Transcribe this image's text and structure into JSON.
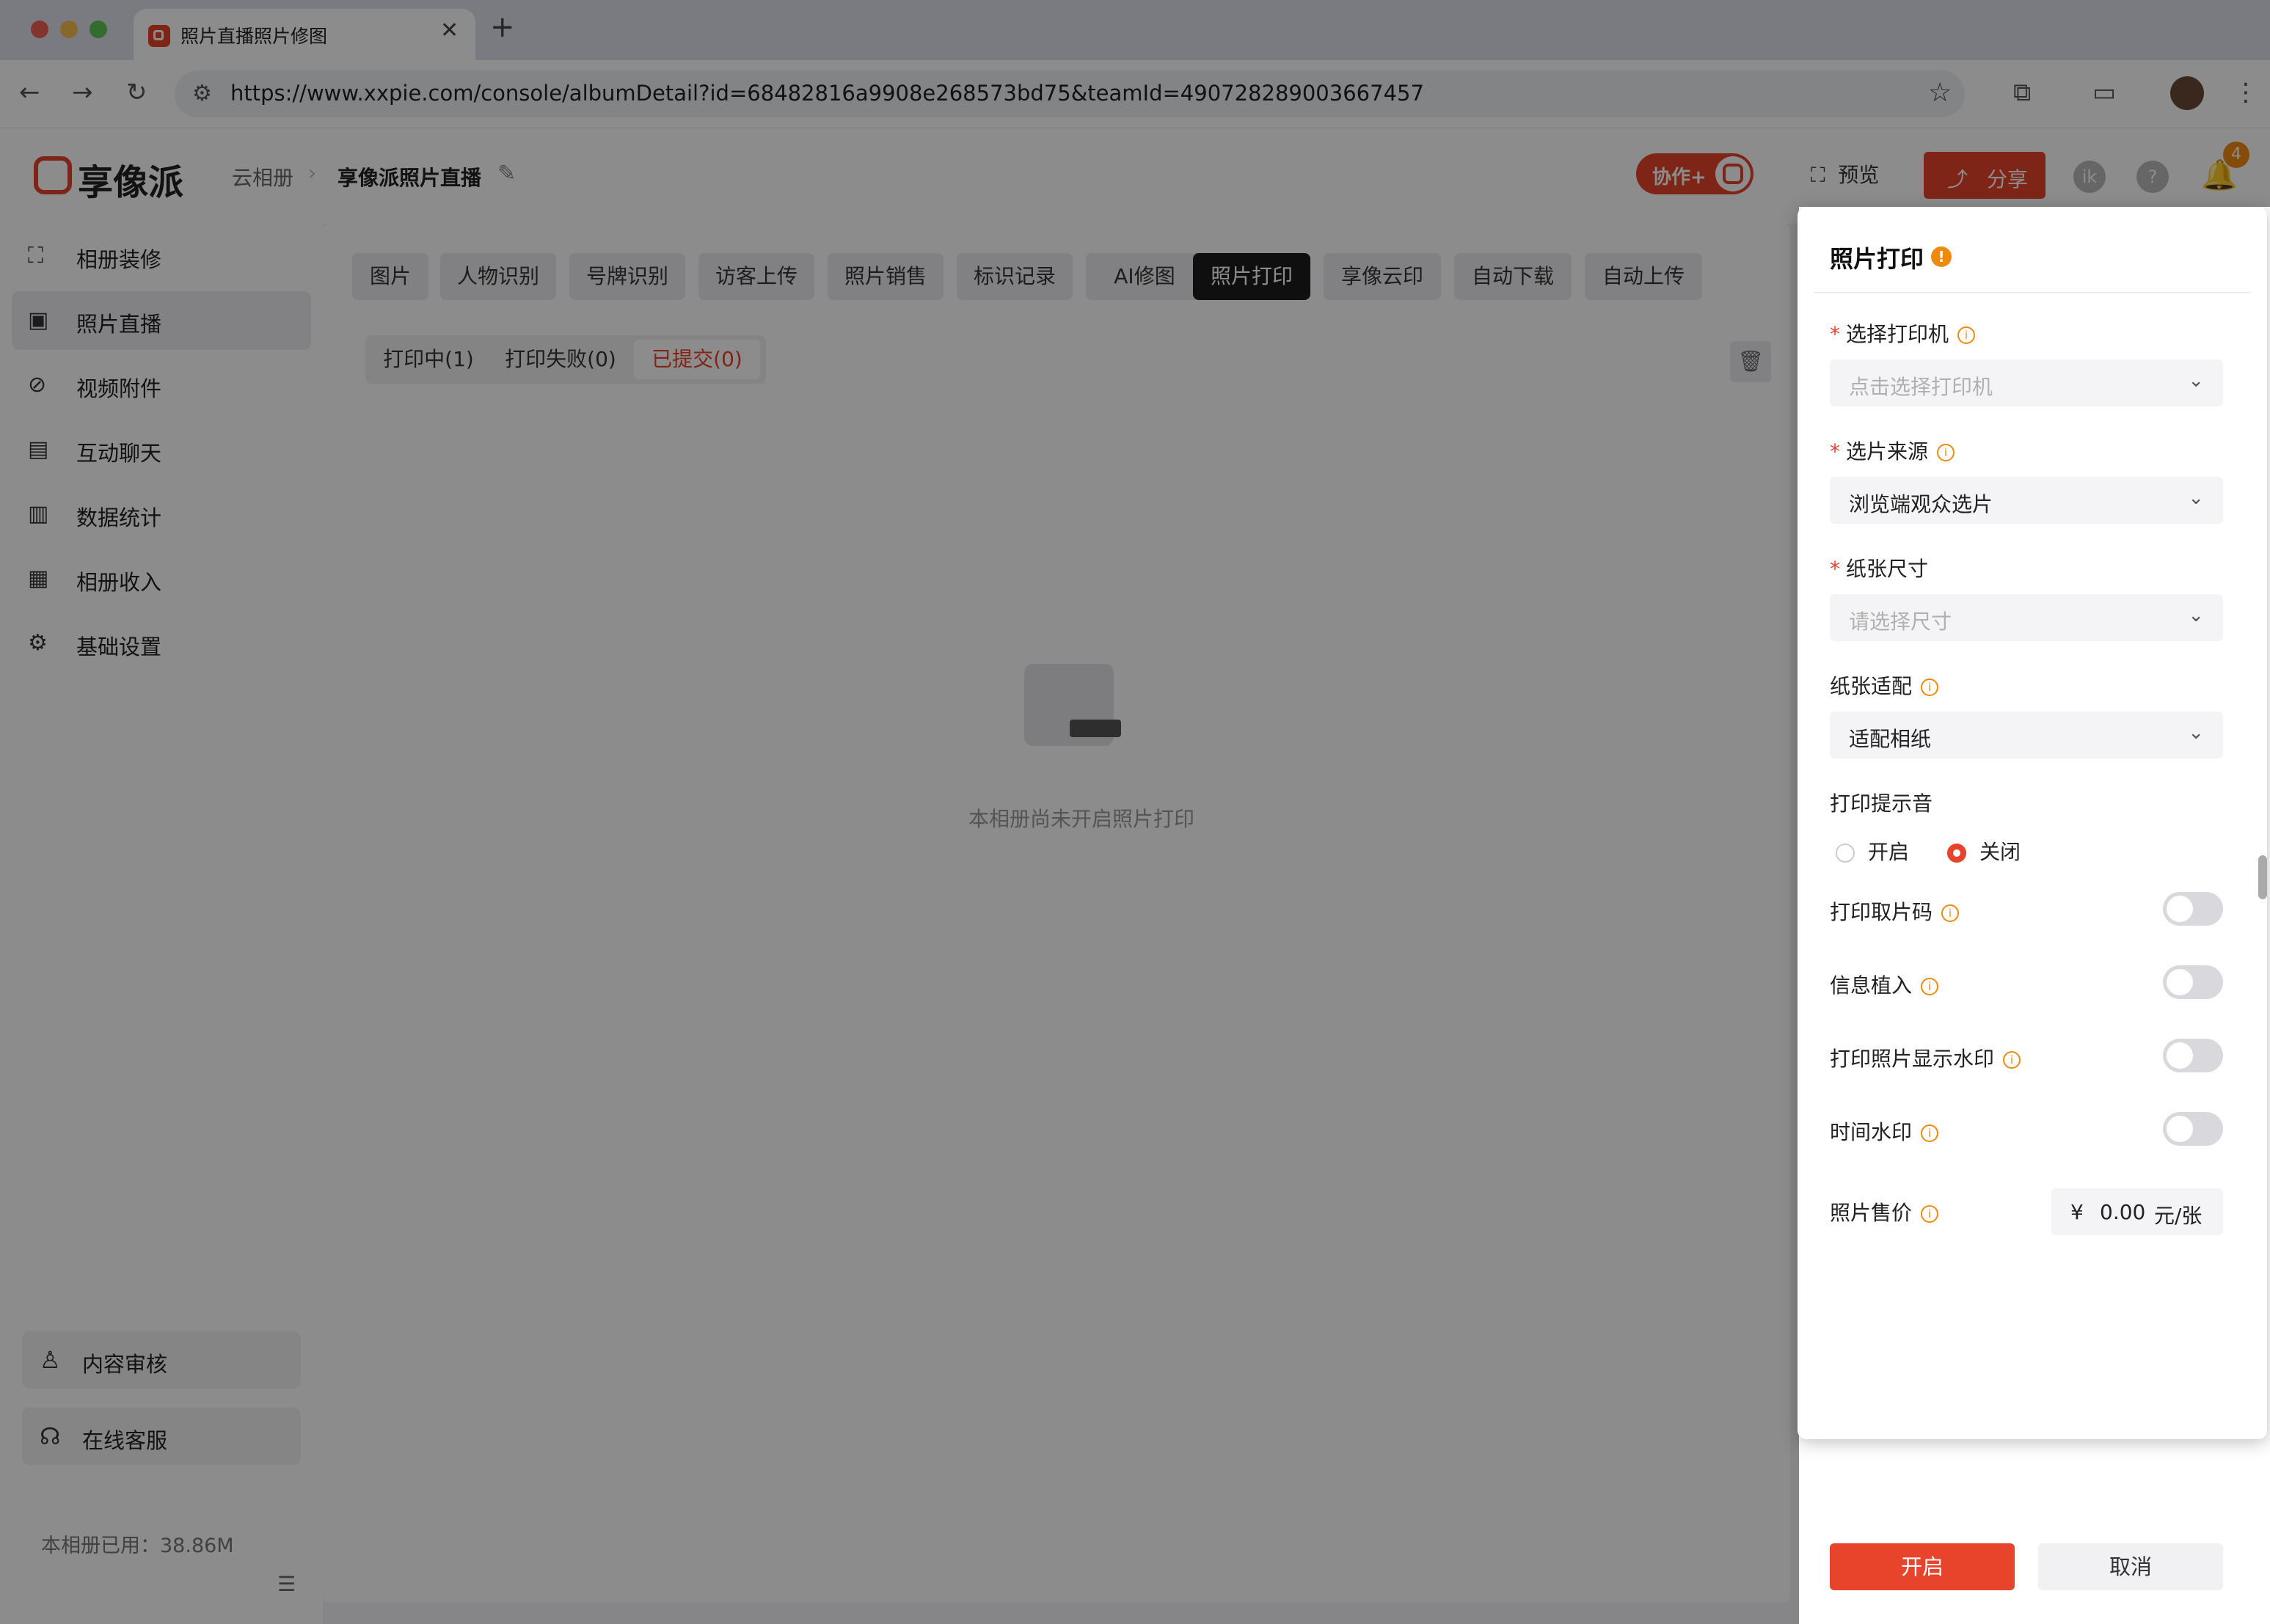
{
  "browser": {
    "tab_title": "照片直播照片修图",
    "tab_close": "✕",
    "new_tab": "+",
    "url": "https://www.xxpie.com/console/albumDetail?id=68482816a9908e268573bd75&teamId=490728289003667457",
    "colors": {
      "close": "#ee5f57",
      "minimize": "#f5bd4f",
      "maximize": "#5fc454"
    }
  },
  "header": {
    "logo_text": "享像派",
    "breadcrumb_root": "云相册",
    "breadcrumb_current": "享像派照片直播",
    "collab_label": "协作+",
    "preview_label": "预览",
    "share_label": "分享",
    "avatar_letter": "ik",
    "help": "?",
    "notification_count": "4"
  },
  "sidebar": {
    "items": [
      {
        "label": "相册装修",
        "icon": "frame-icon"
      },
      {
        "label": "照片直播",
        "icon": "image-icon",
        "active": true
      },
      {
        "label": "视频附件",
        "icon": "paperclip-icon"
      },
      {
        "label": "互动聊天",
        "icon": "chat-icon"
      },
      {
        "label": "数据统计",
        "icon": "chart-icon"
      },
      {
        "label": "相册收入",
        "icon": "wallet-icon"
      },
      {
        "label": "基础设置",
        "icon": "gear-icon"
      }
    ],
    "content_review": "内容审核",
    "online_service": "在线客服",
    "usage": "本相册已用：38.86M"
  },
  "main": {
    "feature_tabs": [
      "图片",
      "人物识别",
      "号牌识别",
      "访客上传",
      "照片销售",
      "标识记录",
      "AI修图",
      "照片打印",
      "享像云印",
      "自动下载",
      "自动上传"
    ],
    "active_feature_tab": "照片打印",
    "sub_tabs": [
      "打印中(1)",
      "打印失败(0)",
      "已提交(0)"
    ],
    "active_sub_tab": "已提交(0)",
    "empty_text": "本相册尚未开启照片打印"
  },
  "drawer": {
    "title": "照片打印",
    "warn_mark": "!",
    "info_mark": "i",
    "required_mark": "*",
    "printer_label": "选择打印机",
    "printer_placeholder": "点击选择打印机",
    "source_label": "选片来源",
    "source_value": "浏览端观众选片",
    "paper_size_label": "纸张尺寸",
    "paper_size_placeholder": "请选择尺寸",
    "paper_fit_label": "纸张适配",
    "paper_fit_value": "适配相纸",
    "sound_label": "打印提示音",
    "sound_on": "开启",
    "sound_off": "关闭",
    "sound_selected": "关闭",
    "pickup_code_label": "打印取片码",
    "pickup_code_enabled": false,
    "info_embed_label": "信息植入",
    "info_embed_enabled": false,
    "watermark_label": "打印照片显示水印",
    "watermark_enabled": false,
    "time_watermark_label": "时间水印",
    "time_watermark_enabled": false,
    "price_label": "照片售价",
    "price_currency": "¥",
    "price_value": "0.00",
    "price_unit": "元/张",
    "enable_button": "开启",
    "cancel_button": "取消"
  },
  "colors": {
    "accent": "#e8442b",
    "warning": "#f08a0f",
    "active_tab": "#1c1c1c"
  }
}
